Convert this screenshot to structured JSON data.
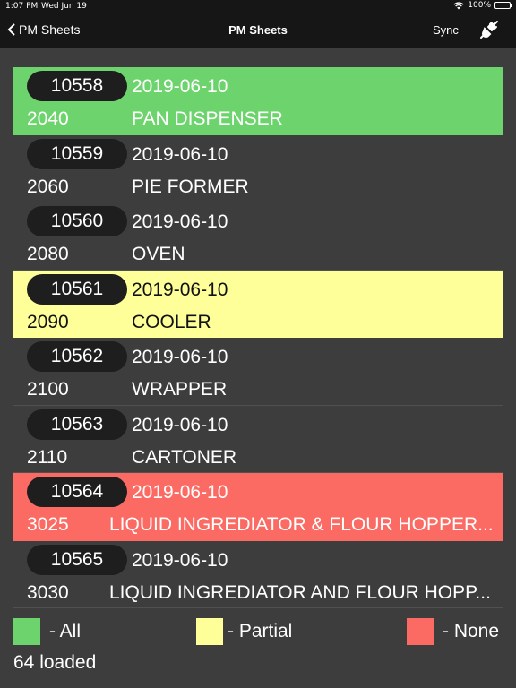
{
  "status_bar": {
    "time": "1:07 PM",
    "date": "Wed Jun 19",
    "battery": "100%"
  },
  "nav": {
    "back_label": "PM Sheets",
    "title": "PM Sheets",
    "sync_label": "Sync"
  },
  "colors": {
    "all": "#6dd46d",
    "partial": "#ffff99",
    "none": "#fb6b63",
    "pill": "#1e1e1e",
    "background": "#3d3d3d"
  },
  "rows": [
    {
      "number": "10558",
      "date": "2019-06-10",
      "code": "2040",
      "description": "PAN DISPENSER",
      "status": "all"
    },
    {
      "number": "10559",
      "date": "2019-06-10",
      "code": "2060",
      "description": "PIE FORMER",
      "status": ""
    },
    {
      "number": "10560",
      "date": "2019-06-10",
      "code": "2080",
      "description": "OVEN",
      "status": ""
    },
    {
      "number": "10561",
      "date": "2019-06-10",
      "code": "2090",
      "description": "COOLER",
      "status": "partial"
    },
    {
      "number": "10562",
      "date": "2019-06-10",
      "code": "2100",
      "description": "WRAPPER",
      "status": ""
    },
    {
      "number": "10563",
      "date": "2019-06-10",
      "code": "2110",
      "description": "CARTONER",
      "status": ""
    },
    {
      "number": "10564",
      "date": "2019-06-10",
      "code": "3025",
      "description": "LIQUID INGREDIATOR & FLOUR HOPPER...",
      "status": "none"
    },
    {
      "number": "10565",
      "date": "2019-06-10",
      "code": "3030",
      "description": "LIQUID INGREDIATOR AND FLOUR HOPP...",
      "status": ""
    }
  ],
  "legend": {
    "all": "- All",
    "partial": "- Partial",
    "none": "- None"
  },
  "loaded_text": "64 loaded"
}
